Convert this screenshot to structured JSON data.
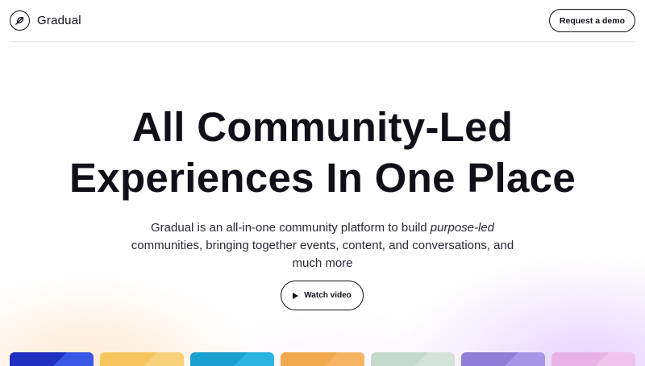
{
  "header": {
    "brand_name": "Gradual",
    "logo_icon": "feather-icon",
    "demo_label": "Request a demo"
  },
  "hero": {
    "title_line1": "All Community-Led",
    "title_line2": "Experiences In One Place",
    "subtitle_part1": "Gradual is an all-in-one community platform to build ",
    "subtitle_emphasis": "purpose-led",
    "subtitle_part2": " communities, bringing together events, content, and conversations, and much more",
    "watch_label": "Watch video",
    "watch_icon": "play-icon"
  },
  "cards": [
    {
      "color": "#1f2fc0",
      "accent": "#3a57e6"
    },
    {
      "color": "#f6c65e",
      "accent": "#f8d27a"
    },
    {
      "color": "#1a9fcf",
      "accent": "#2cb4e0"
    },
    {
      "color": "#f2a84e",
      "accent": "#f5b463"
    },
    {
      "color": "#c6d9cd",
      "accent": "#d2e2d7"
    },
    {
      "color": "#8f7ed8",
      "accent": "#a696e6"
    },
    {
      "color": "#e8b3e4",
      "accent": "#efc3ec"
    }
  ],
  "colors": {
    "text": "#111018",
    "border": "#e6e6ea"
  }
}
